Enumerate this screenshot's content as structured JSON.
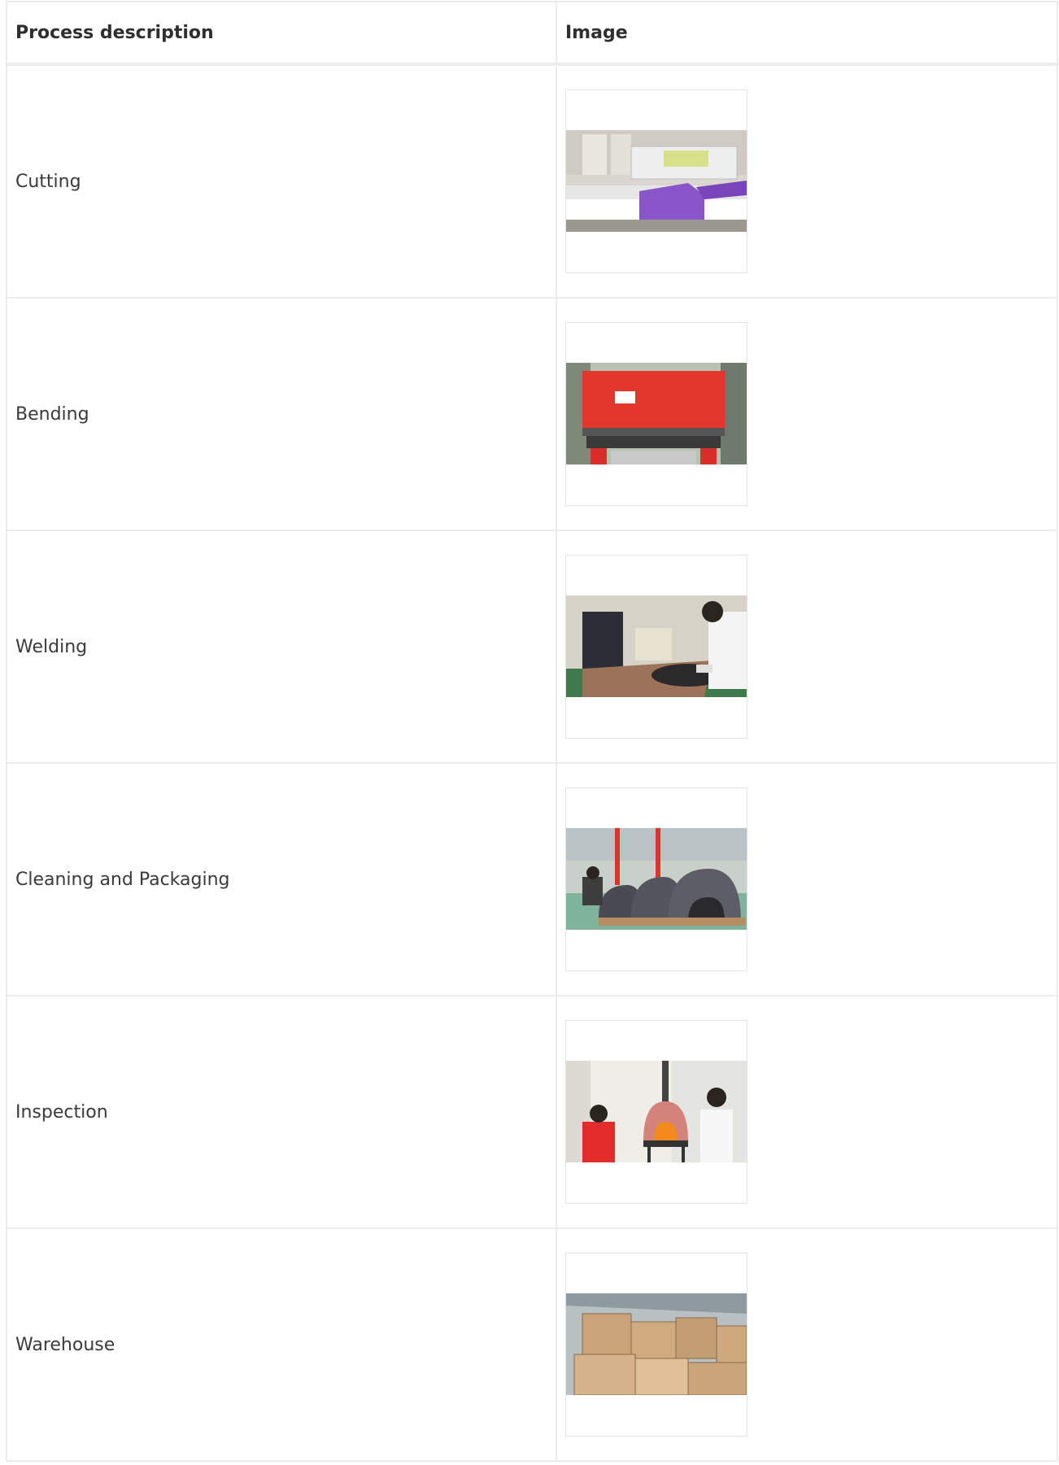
{
  "table": {
    "headers": [
      "Process description",
      "Image"
    ],
    "rows": [
      {
        "description": "Cutting",
        "image_icon": "laser-cutting-machine-photo"
      },
      {
        "description": "Bending",
        "image_icon": "press-brake-bending-photo"
      },
      {
        "description": "Welding",
        "image_icon": "welding-worker-photo"
      },
      {
        "description": "Cleaning and Packaging",
        "image_icon": "oven-cleaning-photo"
      },
      {
        "description": "Inspection",
        "image_icon": "oven-inspection-photo"
      },
      {
        "description": "Warehouse",
        "image_icon": "warehouse-crates-photo"
      }
    ]
  },
  "colors": {
    "border": "#ececec",
    "text": "#333333",
    "machine_purple": "#8a55c8",
    "machine_red": "#e2352b"
  }
}
